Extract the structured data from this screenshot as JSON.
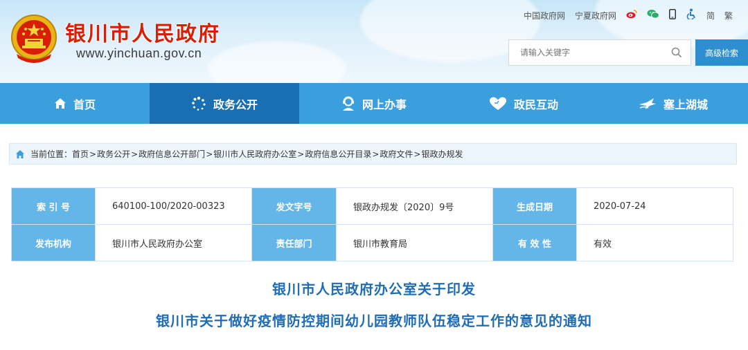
{
  "site": {
    "title": "银川市人民政府",
    "url": "www.yinchuan.gov.cn"
  },
  "toplinks": {
    "china_gov": "中国政府网",
    "ningxia_gov": "宁夏政府网",
    "simplified": "简",
    "traditional": "繁",
    "icons": [
      "weibo-icon",
      "wechat-icon",
      "phone-icon",
      "accessibility-icon"
    ]
  },
  "search": {
    "placeholder": "请输入关键字",
    "advanced_label": "高级检索"
  },
  "nav": {
    "items": [
      {
        "label": "首页",
        "icon": "home-icon"
      },
      {
        "label": "政务公开",
        "icon": "dots-circle-icon",
        "active": true
      },
      {
        "label": "网上办事",
        "icon": "service-person-icon"
      },
      {
        "label": "政民互动",
        "icon": "heart-icon"
      },
      {
        "label": "塞上湖城",
        "icon": "bird-icon"
      }
    ]
  },
  "breadcrumb": {
    "prefix": "当前位置：",
    "items": [
      "首页",
      "政务公开",
      "政府信息公开部门",
      "银川市人民政府办公室",
      "政府信息公开目录",
      "政府文件",
      "银政办规发"
    ],
    "separator": ">"
  },
  "info": {
    "rows": [
      [
        {
          "label": "索 引 号",
          "value": "640100-100/2020-00323"
        },
        {
          "label": "发文字号",
          "value": "银政办规发〔2020〕9号"
        },
        {
          "label": "生成日期",
          "value": "2020-07-24"
        }
      ],
      [
        {
          "label": "发布机构",
          "value": "银川市人民政府办公室"
        },
        {
          "label": "责任部门",
          "value": "银川市教育局"
        },
        {
          "label": "有 效 性",
          "value": "有效"
        }
      ]
    ]
  },
  "document": {
    "title_line1": "银川市人民政府办公室关于印发",
    "title_line2": "银川市关于做好疫情防控期间幼儿园教师队伍稳定工作的意见的通知"
  },
  "colors": {
    "brand_red": "#d81e06",
    "nav_blue": "#3a9fdc",
    "nav_active": "#1a6fb3",
    "label_blue": "#64b6e8",
    "title_blue": "#1f6db4"
  }
}
